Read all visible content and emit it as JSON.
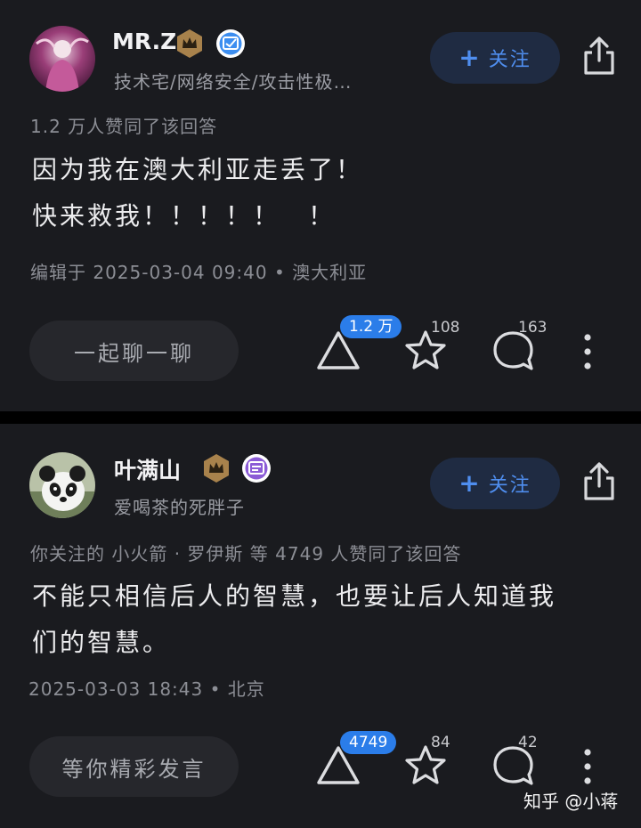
{
  "answers": [
    {
      "author_name": "MR.Z",
      "author_bio": "技术宅/网络安全/攻击性极…",
      "follow_label": "关注",
      "agree_text": "1.2 万人赞同了该回答",
      "body_lines": [
        "因为我在澳大利亚走丢了！",
        "快来救我！！！！！　！"
      ],
      "meta": "编辑于 2025-03-04  09:40 • 澳大利亚",
      "chat_label": "一起聊一聊",
      "upvote_count": "1.2 万",
      "favorite_count": "108",
      "comment_count": "163",
      "verify_badge_color": "#3d8ef0"
    },
    {
      "author_name": "叶满山",
      "author_bio": "爱喝茶的死胖子",
      "follow_label": "关注",
      "agree_text": "你关注的  小火箭 · 罗伊斯  等 4749 人赞同了该回答",
      "body_lines": [
        "不能只相信后人的智慧，也要让后人知道我",
        "们的智慧。"
      ],
      "meta": "2025-03-03  18:43 • 北京",
      "chat_label": "等你精彩发言",
      "upvote_count": "4749",
      "favorite_count": "84",
      "comment_count": "42",
      "verify_badge_color": "#8b5bd6"
    }
  ],
  "watermark": "知乎 @小蒋",
  "icons": [
    "crown-badge-icon",
    "verified-badge-icon",
    "share-icon",
    "upvote-triangle-icon",
    "star-icon",
    "comment-bubble-icon",
    "more-vertical-icon"
  ],
  "colors": {
    "background": "#1a1b1f",
    "accent": "#4f8eef",
    "pill": "#2b7de9",
    "crown": "#a8824c"
  }
}
